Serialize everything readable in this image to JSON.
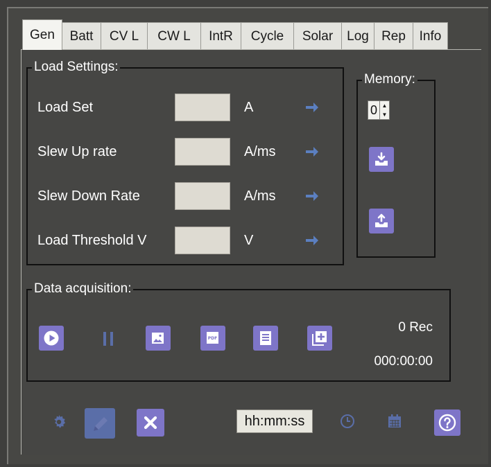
{
  "tabs": [
    {
      "label": "Gen",
      "active": true
    },
    {
      "label": "Batt"
    },
    {
      "label": "CV L"
    },
    {
      "label": "CW L"
    },
    {
      "label": "IntR"
    },
    {
      "label": "Cycle"
    },
    {
      "label": "Solar"
    },
    {
      "label": "Log"
    },
    {
      "label": "Rep"
    },
    {
      "label": "Info"
    }
  ],
  "load_settings": {
    "title": "Load Settings:",
    "rows": [
      {
        "label": "Load Set",
        "value": "",
        "unit": "A"
      },
      {
        "label": "Slew Up rate",
        "value": "",
        "unit": "A/ms"
      },
      {
        "label": "Slew Down Rate",
        "value": "",
        "unit": "A/ms"
      },
      {
        "label": "Load Threshold V",
        "value": "",
        "unit": "V"
      }
    ]
  },
  "memory": {
    "title": "Memory:",
    "slot": "0"
  },
  "data_acquisition": {
    "title": "Data acquisition:",
    "rec_count": "0 Rec",
    "elapsed": "000:00:00"
  },
  "bottom": {
    "time_format": "hh:mm:ss"
  },
  "colors": {
    "button_purple": "#7e75c8",
    "disabled_blue": "#5a6ea8",
    "arrow_blue": "#5b7fc0",
    "background": "#464644"
  },
  "icons": [
    "arrow-right-icon",
    "download-icon",
    "upload-icon",
    "play-icon",
    "pause-icon",
    "image-icon",
    "pdf-icon",
    "report-icon",
    "add-icon",
    "gear-icon",
    "edit-icon",
    "close-icon",
    "clock-icon",
    "calendar-icon",
    "help-icon"
  ]
}
